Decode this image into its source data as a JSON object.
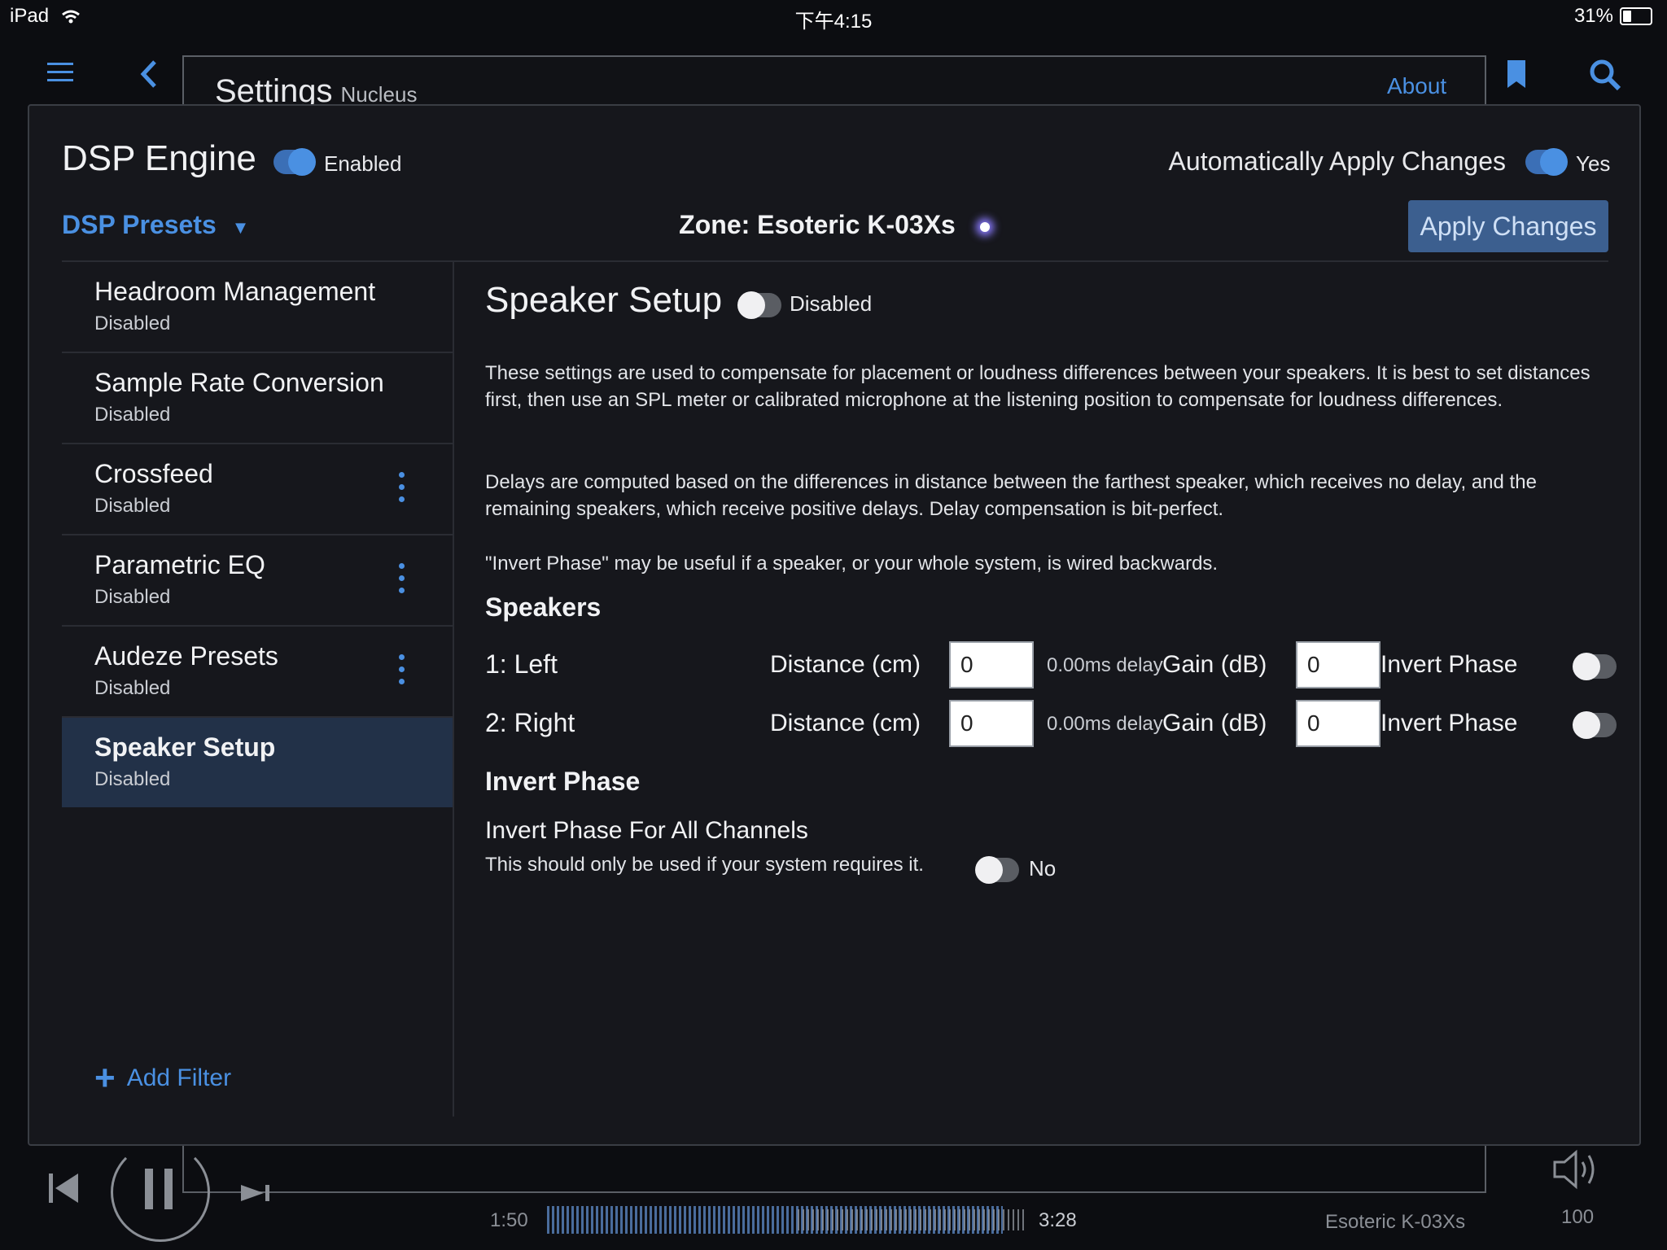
{
  "status_bar": {
    "device": "iPad",
    "time": "下午4:15",
    "battery": "31%"
  },
  "header": {
    "title": "Settings",
    "subtitle": "Nucleus",
    "about": "About"
  },
  "dsp": {
    "title": "DSP Engine",
    "enabled_label": "Enabled",
    "auto_apply_label": "Automatically Apply Changes",
    "auto_apply_value": "Yes",
    "presets_label": "DSP Presets",
    "zone_label": "Zone: Esoteric K-03Xs",
    "apply_button": "Apply Changes"
  },
  "filters": [
    {
      "name": "Headroom Management",
      "status": "Disabled"
    },
    {
      "name": "Sample Rate Conversion",
      "status": "Disabled"
    },
    {
      "name": "Crossfeed",
      "status": "Disabled"
    },
    {
      "name": "Parametric EQ",
      "status": "Disabled"
    },
    {
      "name": "Audeze Presets",
      "status": "Disabled"
    },
    {
      "name": "Speaker Setup",
      "status": "Disabled"
    }
  ],
  "add_filter": "Add Filter",
  "speaker_setup": {
    "title": "Speaker Setup",
    "toggle_label": "Disabled",
    "desc1": "These settings are used to compensate for placement or loudness differences between your speakers. It is best to set distances first, then use an SPL meter or calibrated microphone at the listening position to compensate for loudness differences.",
    "desc2": "Delays are computed based on the differences in distance between the farthest speaker, which receives no delay, and the remaining speakers, which receive positive delays. Delay compensation is bit-perfect.",
    "desc3": "\"Invert Phase\" may be useful if a speaker, or your whole system, is wired backwards.",
    "speakers_heading": "Speakers",
    "speakers": [
      {
        "name": "1: Left",
        "distance_label": "Distance (cm)",
        "distance": "0",
        "delay": "0.00ms delay",
        "gain_label": "Gain (dB)",
        "gain": "0",
        "invert_label": "Invert Phase"
      },
      {
        "name": "2: Right",
        "distance_label": "Distance (cm)",
        "distance": "0",
        "delay": "0.00ms delay",
        "gain_label": "Gain (dB)",
        "gain": "0",
        "invert_label": "Invert Phase"
      }
    ],
    "invert_heading": "Invert Phase",
    "invert_all_title": "Invert Phase For All Channels",
    "invert_all_desc": "This should only be used if your system requires it.",
    "invert_all_value": "No"
  },
  "player": {
    "elapsed": "1:50",
    "total": "3:28",
    "zone": "Esoteric K-03Xs",
    "volume": "100"
  },
  "colors": {
    "accent": "#4a90e2",
    "panel": "#16171c",
    "selected": "#223148",
    "button": "#3c5f8f"
  },
  "icons": [
    "wifi-icon",
    "battery-icon",
    "menu-icon",
    "back-icon",
    "bookmark-icon",
    "search-icon",
    "kebab-icon",
    "plus-icon",
    "previous-icon",
    "pause-icon",
    "next-icon",
    "volume-icon"
  ]
}
